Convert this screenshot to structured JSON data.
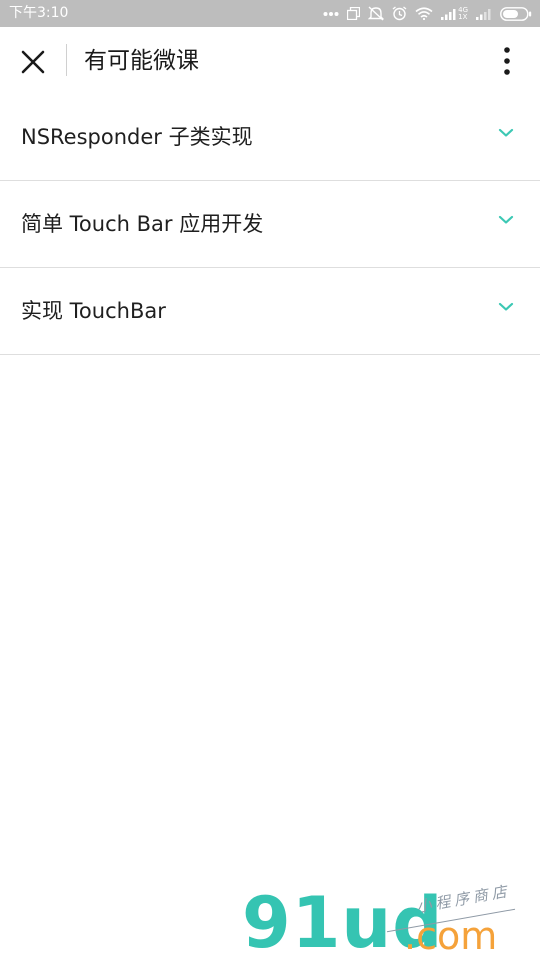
{
  "status_bar": {
    "time": "下午3:10",
    "net_top": "4G",
    "net_bottom": "1X",
    "icons": [
      "more-dots-icon",
      "screen-icon",
      "mute-icon",
      "alarm-icon",
      "wifi-icon",
      "signal-icon",
      "signal-icon",
      "battery-icon"
    ]
  },
  "header": {
    "title": "有可能微课",
    "close_icon": "close-icon",
    "more_icon": "more-vertical-icon"
  },
  "lessons": [
    {
      "label": "NSResponder 子类实现",
      "icon": "chevron-down-icon"
    },
    {
      "label": "简单 Touch Bar 应用开发",
      "icon": "chevron-down-icon"
    },
    {
      "label": "实现 TouchBar",
      "icon": "chevron-down-icon"
    }
  ],
  "watermark": {
    "logo": "91ud",
    "domain": ".com",
    "tagline": "小程序商店"
  },
  "colors": {
    "accent": "#3cc8b4",
    "status_bar": "#bdbdbd",
    "watermark_teal": "#35c4b2",
    "watermark_orange": "#f5a23a"
  }
}
